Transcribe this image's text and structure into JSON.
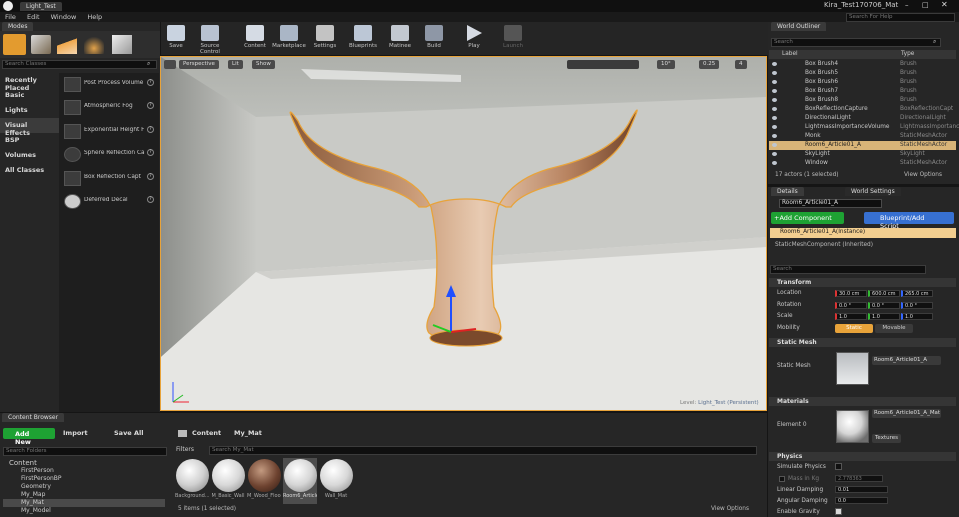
{
  "window": {
    "project_tab": "Light_Test",
    "title": "Kira_Test170706_Mat",
    "search_help_placeholder": "Search For Help",
    "menu": [
      "File",
      "Edit",
      "Window",
      "Help"
    ]
  },
  "modes": {
    "tab": "Modes",
    "search_placeholder": "Search Classes",
    "categories": [
      "Recently Placed",
      "Basic",
      "Lights",
      "Visual Effects",
      "BSP",
      "Volumes",
      "All Classes"
    ],
    "selected_category": "Visual Effects",
    "items": [
      "Post Process Volume",
      "Atmospheric Fog",
      "Exponential Height F",
      "Sphere Reflection Ca",
      "Box Reflection Capt",
      "Deferred Decal"
    ]
  },
  "toolbar": {
    "buttons": [
      "Save",
      "Source Control",
      "Content",
      "Marketplace",
      "Settings",
      "Blueprints",
      "Matinee",
      "Build",
      "Play",
      "Launch"
    ]
  },
  "viewport": {
    "perspective_label": "Perspective",
    "lit_label": "Lit",
    "show_label": "Show",
    "angle_snap": "10°",
    "scale_snap": "0.25",
    "camera_speed": "4",
    "level_label": "Level:",
    "level_name": "Light_Test (Persistent)"
  },
  "outliner": {
    "tab": "World Outliner",
    "search_placeholder": "Search",
    "col_label": "Label",
    "col_type": "Type",
    "rows": [
      {
        "label": "Box Brush4",
        "type": "Brush"
      },
      {
        "label": "Box Brush5",
        "type": "Brush"
      },
      {
        "label": "Box Brush6",
        "type": "Brush"
      },
      {
        "label": "Box Brush7",
        "type": "Brush"
      },
      {
        "label": "Box Brush8",
        "type": "Brush"
      },
      {
        "label": "BoxReflectionCapture",
        "type": "BoxReflectionCapt"
      },
      {
        "label": "DirectionalLight",
        "type": "DirectionalLight"
      },
      {
        "label": "LightmassImportanceVolume",
        "type": "LightmassImportanc"
      },
      {
        "label": "Monk",
        "type": "StaticMeshActor"
      },
      {
        "label": "Room6_Article01_A",
        "type": "StaticMeshActor"
      },
      {
        "label": "SkyLight",
        "type": "SkyLight"
      },
      {
        "label": "Window",
        "type": "StaticMeshActor"
      }
    ],
    "selected_row": "Room6_Article01_A",
    "status": "17 actors (1 selected)",
    "view_options": "View Options"
  },
  "details": {
    "tab_details": "Details",
    "tab_world": "World Settings",
    "actor_name": "Room6_Article01_A",
    "add_component": "+Add Component",
    "blueprint_script": "Blueprint/Add Script",
    "instance_label": "Room6_Article01_A(Instance)",
    "component_label": "StaticMeshComponent (Inherited)",
    "search_placeholder": "Search",
    "transform": {
      "header": "Transform",
      "location_label": "Location",
      "location": [
        "30.0 cm",
        "600.0 cm",
        "265.0 cm"
      ],
      "rotation_label": "Rotation",
      "rotation": [
        "0.0 °",
        "0.0 °",
        "0.0 °"
      ],
      "scale_label": "Scale",
      "scale": [
        "1.0",
        "1.0",
        "1.0"
      ],
      "mobility_label": "Mobility",
      "mobility_static": "Static",
      "mobility_movable": "Movable"
    },
    "static_mesh": {
      "header": "Static Mesh",
      "label": "Static Mesh",
      "value": "Room6_Article01_A"
    },
    "materials": {
      "header": "Materials",
      "element_label": "Element 0",
      "value": "Room6_Article01_A_Mat",
      "textures_label": "Textures"
    },
    "physics": {
      "header": "Physics",
      "simulate": "Simulate Physics",
      "mass_label": "Mass in Kg",
      "mass_value": "2.778363",
      "linear_damping_label": "Linear Damping",
      "linear_damping": "0.01",
      "angular_damping_label": "Angular Damping",
      "angular_damping": "0.0",
      "gravity_label": "Enable Gravity"
    }
  },
  "content_browser": {
    "tab": "Content Browser",
    "add_new": "Add New",
    "import": "Import",
    "save_all": "Save All",
    "path": [
      "Content",
      "My_Mat"
    ],
    "search_folders_placeholder": "Search Folders",
    "filters_label": "Filters",
    "search_placeholder": "Search My_Mat",
    "tree": [
      "Content",
      "FirstPerson",
      "FirstPersonBP",
      "Geometry",
      "My_Map",
      "My_Mat",
      "My_Model"
    ],
    "selected_folder": "My_Mat",
    "assets": [
      "Background...",
      "M_Basic_Wall",
      "M_Wood_Floor_Walnut",
      "Room6_Article01_A",
      "Wall_Mat"
    ],
    "status": "5 items (1 selected)",
    "view_options": "View Options"
  },
  "colors": {
    "accent_orange": "#e8a33a",
    "selection": "#ffc15a",
    "add_green": "#1ea233",
    "blueprint_blue": "#3770d1"
  }
}
